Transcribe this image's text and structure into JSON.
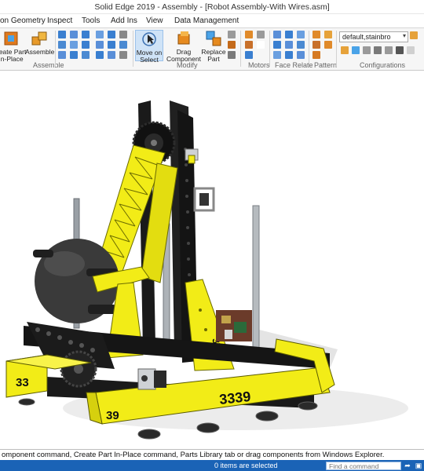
{
  "window": {
    "title": "Solid Edge 2019 - Assembly - [Robot Assembly-With Wires.asm]"
  },
  "tabs": [
    "on Geometry",
    "Inspect",
    "Tools",
    "Add Ins",
    "View",
    "Data Management"
  ],
  "ribbon": {
    "create_part_label": "reate Part\nIn-Place",
    "assemble_label": "Assemble",
    "move_on_select_label": "Move on\nSelect",
    "drag_component_label": "Drag\nComponent",
    "replace_part_label": "Replace\nPart",
    "groups": {
      "assemble": "Assemble",
      "modify": "Modify",
      "motors": "Motors",
      "face_relate": "Face Relate",
      "pattern": "Pattern",
      "configurations": "Configurations"
    },
    "configuration_value": "default,stainbro"
  },
  "model": {
    "team_number_front": "3339",
    "team_number_side": "33",
    "team_number_corner": "39",
    "team_number_arm": "3339"
  },
  "prompt_text": "omponent command, Create Part In-Place command, Parts Library tab or drag components from Windows Explorer.",
  "status": {
    "selection_count": "0 items are selected",
    "find_placeholder": "Find a command"
  },
  "colors": {
    "accent": "#1a63b6",
    "robot_yellow": "#f2ec17",
    "robot_black": "#1b1b1b"
  }
}
